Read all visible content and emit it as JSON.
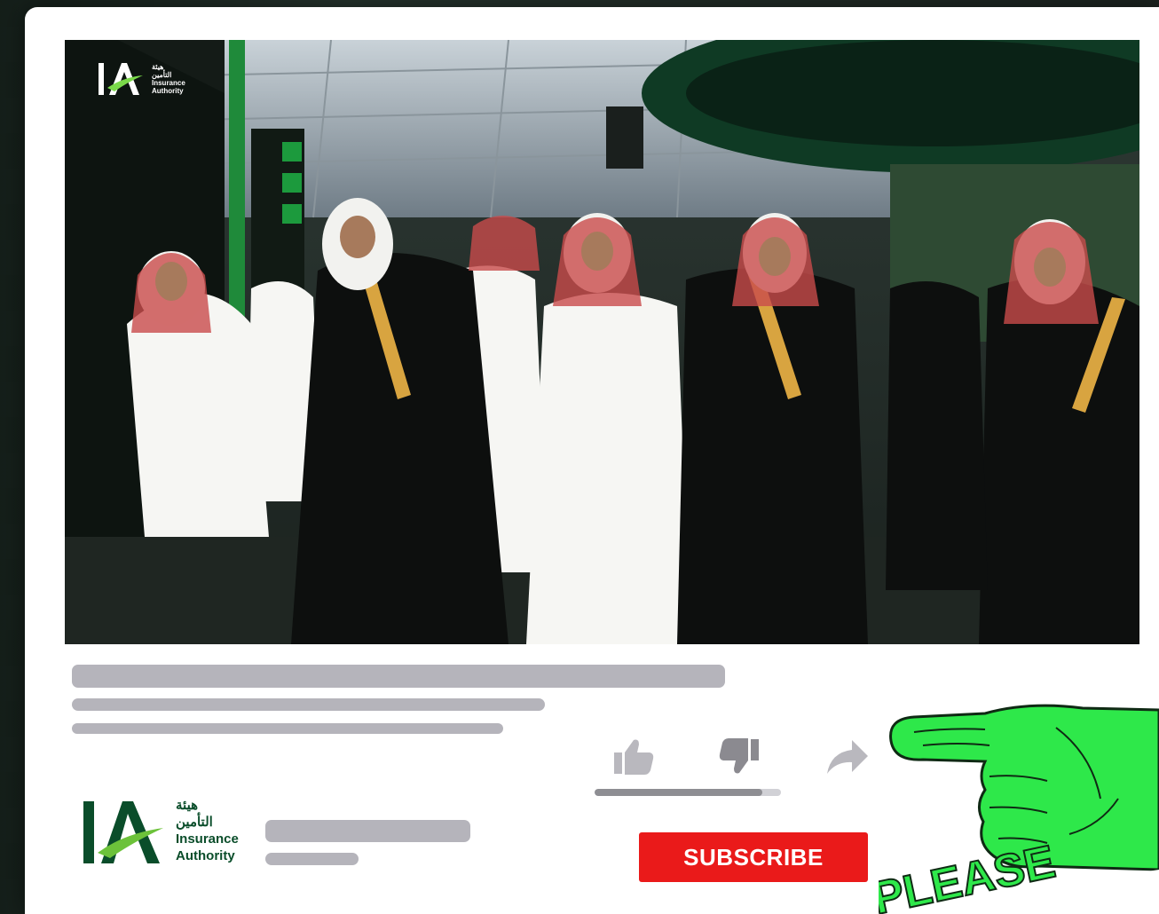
{
  "video": {
    "overlay_logo": {
      "mark": "IA",
      "arabic_line1": "هيئة",
      "arabic_line2": "التأمين",
      "english_line1": "Insurance",
      "english_line2": "Authority"
    }
  },
  "engagement": {
    "like_icon": "thumbs-up-icon",
    "dislike_icon": "thumbs-down-icon",
    "share_icon": "share-arrow-icon",
    "like_ratio": 0.9
  },
  "channel": {
    "logo_mark": "IA",
    "arabic_line1": "هيئة",
    "arabic_line2": "التأمين",
    "english_line1": "Insurance",
    "english_line2": "Authority"
  },
  "subscribe": {
    "label": "SUBSCRIBE"
  },
  "decor": {
    "hand_text": "PLEASE"
  },
  "colors": {
    "subscribe_red": "#ea1a1a",
    "hand_green": "#2ee84a",
    "brand_green": "#0a4d2a",
    "skeleton_gray": "#b5b4bb"
  }
}
